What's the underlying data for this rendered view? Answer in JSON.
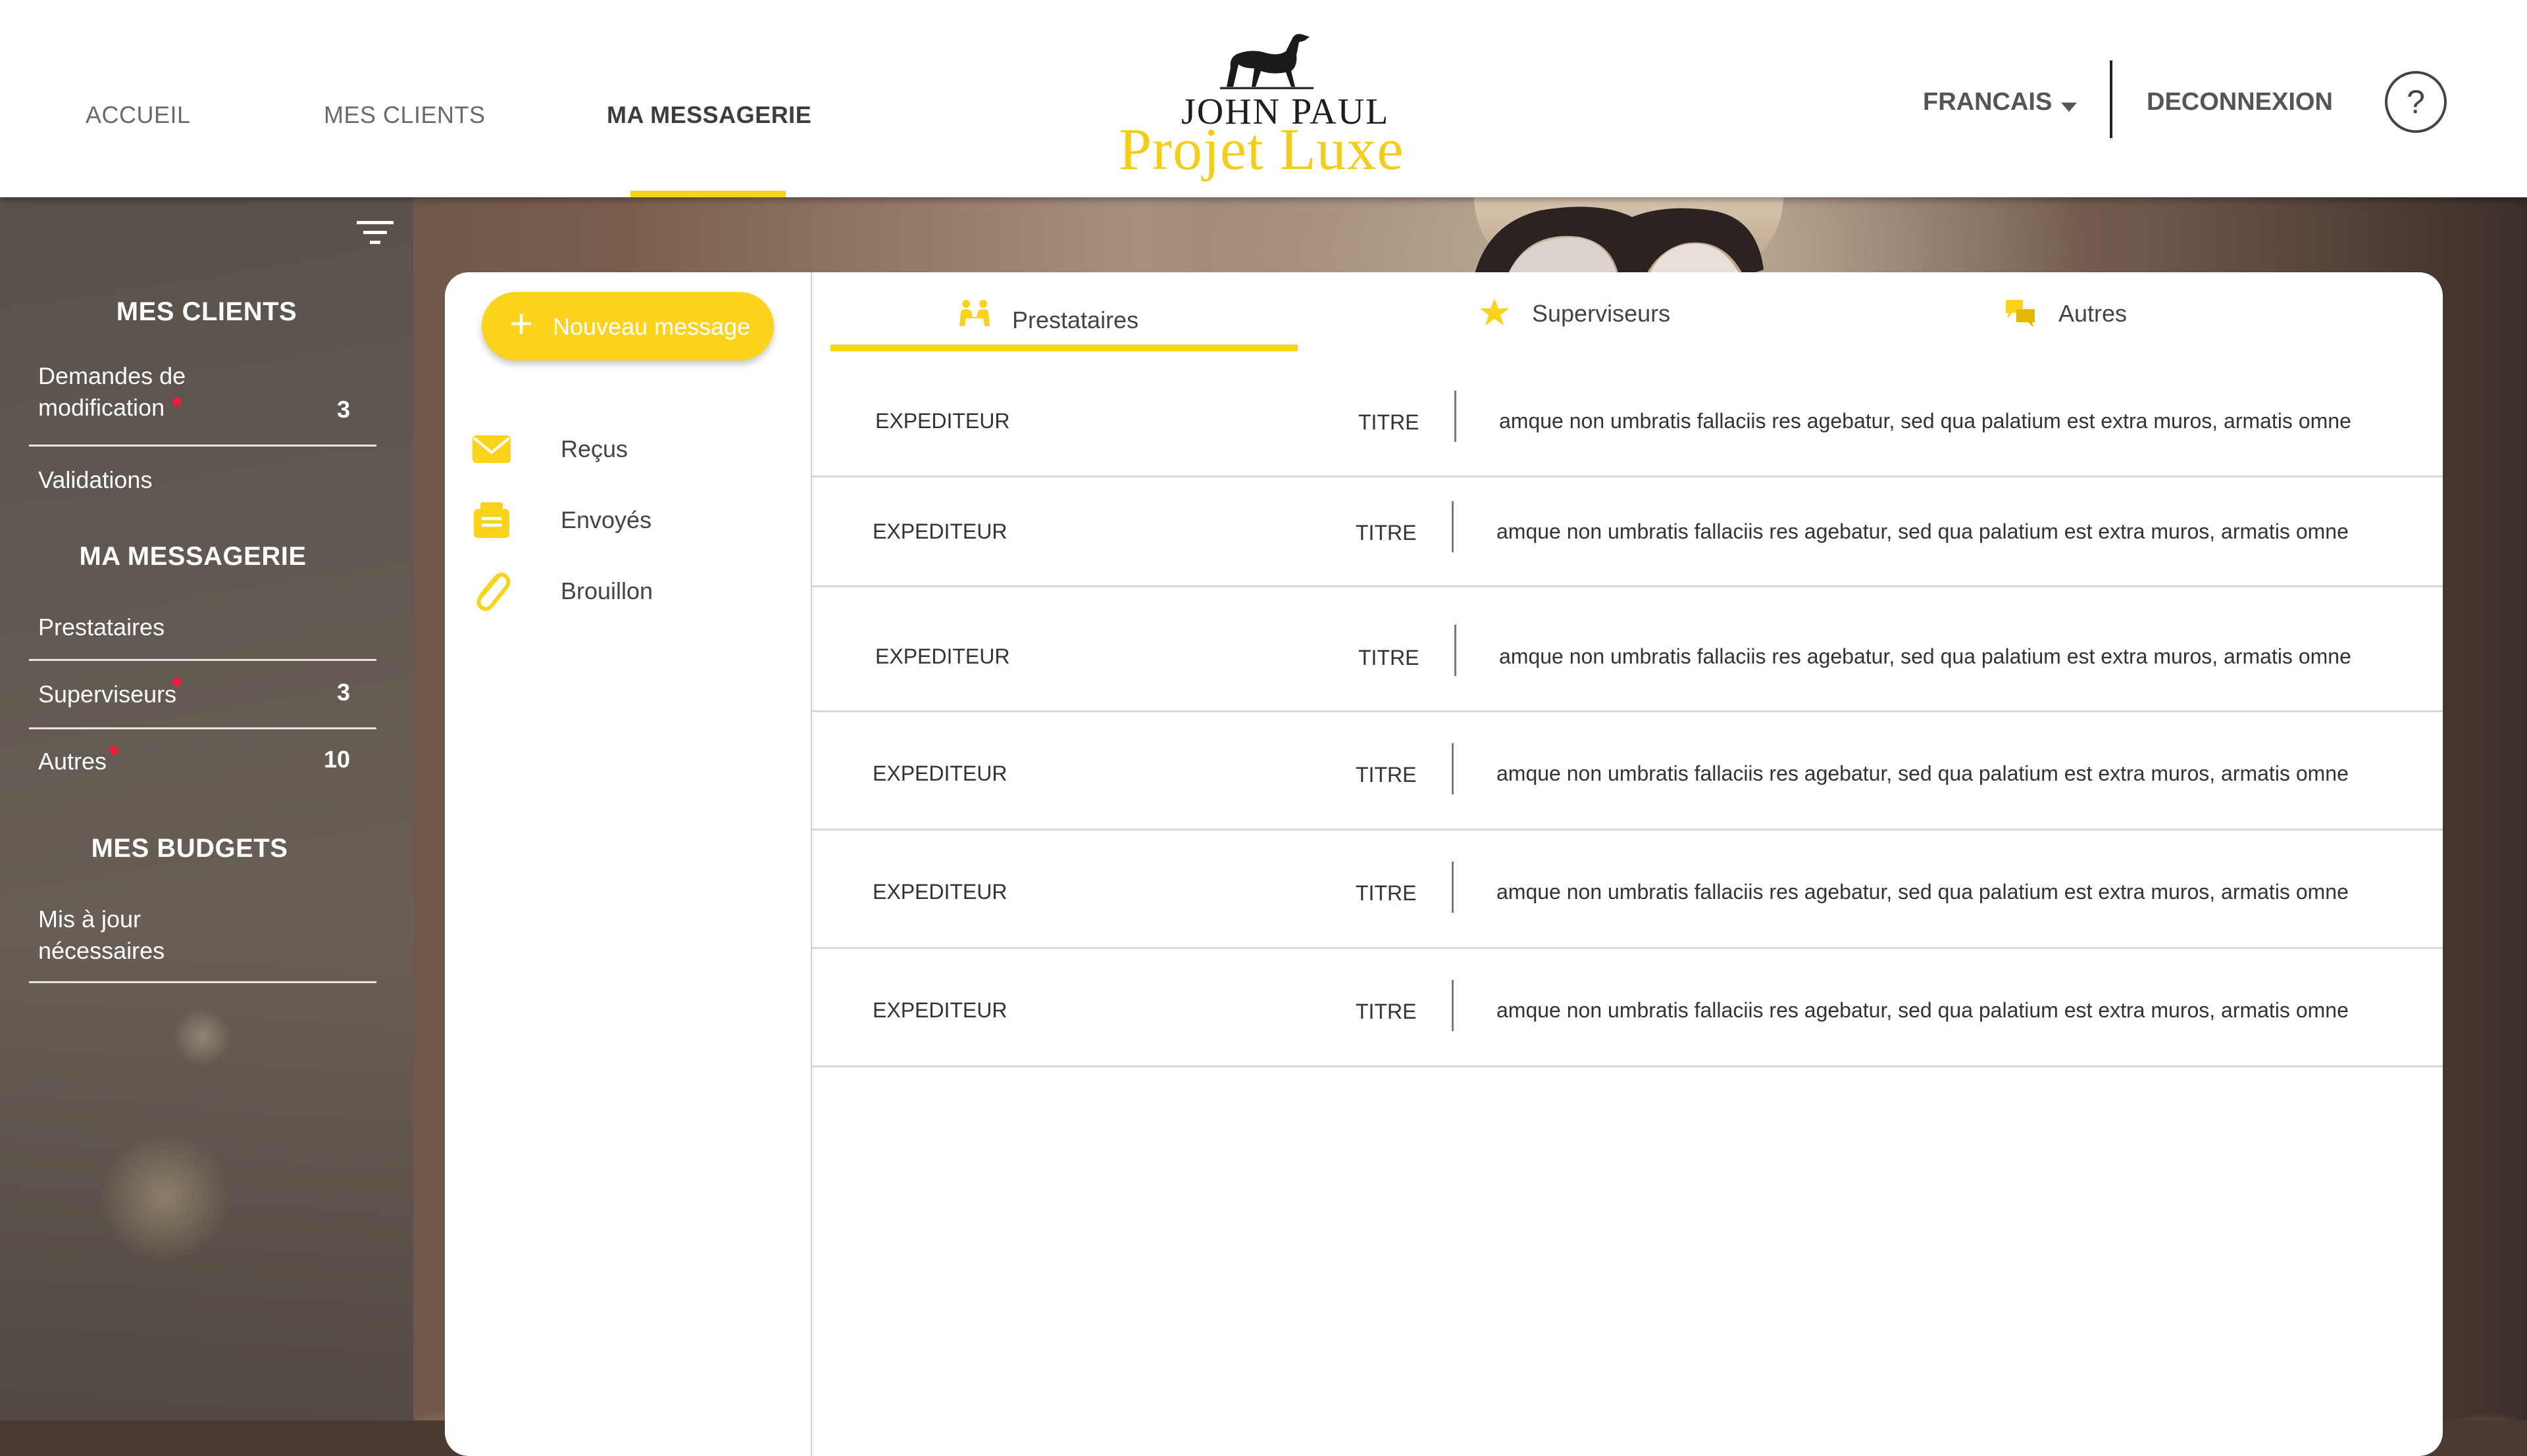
{
  "header": {
    "nav": [
      {
        "label": "ACCUEIL",
        "active": false
      },
      {
        "label": "MES CLIENTS",
        "active": false
      },
      {
        "label": "MA MESSAGERIE",
        "active": true
      }
    ],
    "logo": {
      "line1": "JOHN PAUL",
      "line2": "Projet Luxe"
    },
    "language": "FRANCAIS",
    "logout": "DECONNEXION",
    "help": "?"
  },
  "sidebar": {
    "sections": [
      {
        "title": "MES CLIENTS",
        "items": [
          {
            "label": "Demandes de modification",
            "count": "3",
            "alert": true
          },
          {
            "label": "Validations",
            "count": "",
            "alert": false
          }
        ]
      },
      {
        "title": "MA MESSAGERIE",
        "items": [
          {
            "label": "Prestataires",
            "count": "",
            "alert": false
          },
          {
            "label": "Superviseurs",
            "count": "3",
            "alert": true
          },
          {
            "label": "Autres",
            "count": "10",
            "alert": true
          }
        ]
      },
      {
        "title": "MES BUDGETS",
        "items": [
          {
            "label": "Mis à jour nécessaires",
            "count": "",
            "alert": false
          }
        ]
      }
    ]
  },
  "messaging": {
    "new_message": "Nouveau message",
    "folders": [
      {
        "label": "Reçus",
        "icon": "envelope-icon"
      },
      {
        "label": "Envoyés",
        "icon": "outbox-icon"
      },
      {
        "label": "Brouillon",
        "icon": "paperclip-icon"
      }
    ],
    "tabs": [
      {
        "label": "Prestataires",
        "icon": "people-icon",
        "active": true
      },
      {
        "label": "Superviseurs",
        "icon": "star-icon",
        "active": false
      },
      {
        "label": "Autres",
        "icon": "chat-icon",
        "active": false
      }
    ],
    "messages": [
      {
        "sender": "EXPEDITEUR",
        "title": "TITRE",
        "preview": "amque non umbratis fallaciis res agebatur, sed qua palatium est extra muros, armatis omne"
      },
      {
        "sender": "EXPEDITEUR",
        "title": "TITRE",
        "preview": "amque non umbratis fallaciis res agebatur, sed qua palatium est extra muros, armatis omne"
      },
      {
        "sender": "EXPEDITEUR",
        "title": "TITRE",
        "preview": "amque non umbratis fallaciis res agebatur, sed qua palatium est extra muros, armatis omne"
      },
      {
        "sender": "EXPEDITEUR",
        "title": "TITRE",
        "preview": "amque non umbratis fallaciis res agebatur, sed qua palatium est extra muros, armatis omne"
      },
      {
        "sender": "EXPEDITEUR",
        "title": "TITRE",
        "preview": "amque non umbratis fallaciis res agebatur, sed qua palatium est extra muros, armatis omne"
      },
      {
        "sender": "EXPEDITEUR",
        "title": "TITRE",
        "preview": "amque non umbratis fallaciis res agebatur, sed qua palatium est extra muros, armatis omne"
      }
    ]
  },
  "colors": {
    "accent": "#f7d418",
    "alert": "#e8203c",
    "text": "#3a3a3a"
  }
}
